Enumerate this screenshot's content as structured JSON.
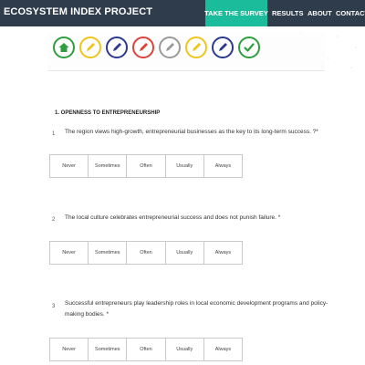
{
  "nav": {
    "brand": "ECOSYSTEM INDEX PROJECT",
    "take_survey": "TAKE THE SURVEY",
    "results": "RESULTS",
    "about": "ABOUT",
    "contact": "CONTACT"
  },
  "steps": [
    {
      "icon": "home-icon",
      "color": "#2e9e3e",
      "state": "active"
    },
    {
      "icon": "pencil-icon",
      "color": "#f0c419",
      "state": "pending"
    },
    {
      "icon": "pencil-icon",
      "color": "#2b3a8f",
      "state": "pending"
    },
    {
      "icon": "pencil-icon",
      "color": "#e0413a",
      "state": "pending"
    },
    {
      "icon": "pencil-icon",
      "color": "#9a9a9a",
      "state": "pending"
    },
    {
      "icon": "pencil-icon",
      "color": "#f0c419",
      "state": "pending"
    },
    {
      "icon": "pencil-icon",
      "color": "#2b3a8f",
      "state": "pending"
    },
    {
      "icon": "check-icon",
      "color": "#2e9e3e",
      "state": "done"
    }
  ],
  "section": {
    "title": "1. OPENNESS TO ENTREPRENEURSHIP"
  },
  "questions": [
    {
      "number": "1",
      "text": "The region views high-growth, entrepreneurial businesses as the key to its long-term success. ?*"
    },
    {
      "number": "2",
      "text": "The local culture celebrates entrepreneurial success and does not punish failure. *"
    },
    {
      "number": "3",
      "text": "Successful entrepreneurs play leadership roles in local economic development programs and policy-making bodies. *"
    }
  ],
  "options": [
    "Never",
    "Sometimes",
    "Often",
    "Usually",
    "Always"
  ]
}
